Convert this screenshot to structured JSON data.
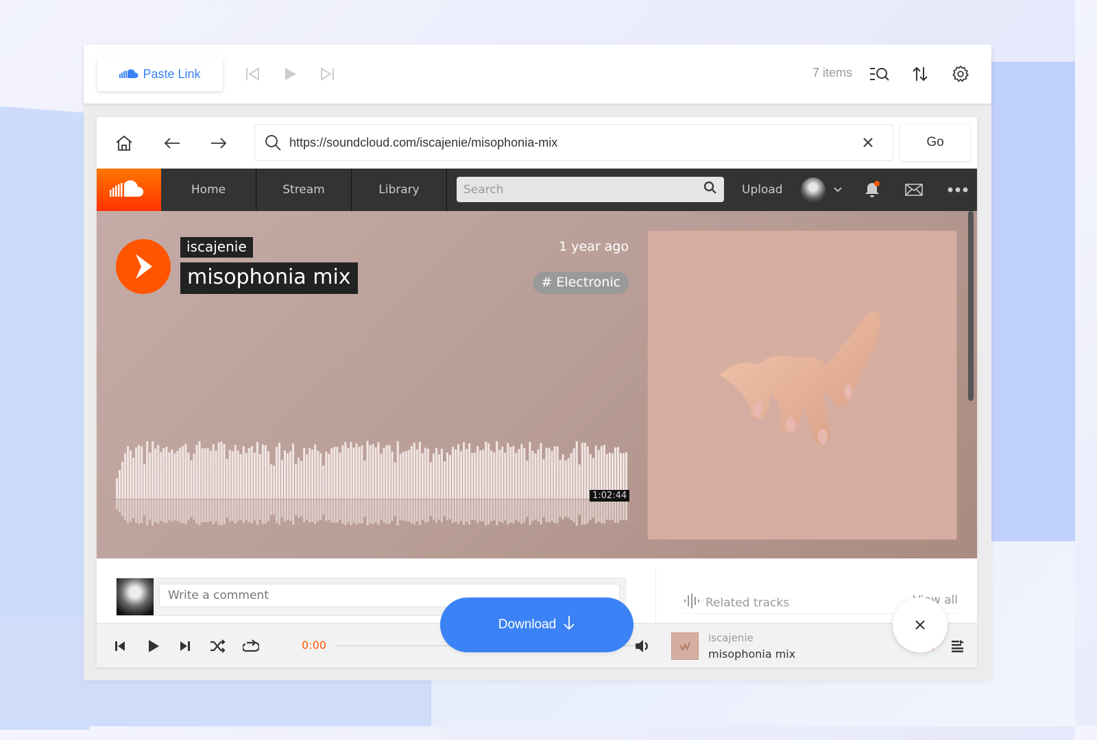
{
  "toolbar": {
    "paste_label": "Paste Link",
    "items_count": "7 items",
    "icons": [
      "cloud-icon",
      "skip-back-icon",
      "play-icon",
      "skip-forward-icon",
      "search-list-icon",
      "sort-icon",
      "settings-icon"
    ]
  },
  "browser": {
    "url": "https://soundcloud.com/iscajenie/misophonia-mix",
    "go_label": "Go"
  },
  "soundcloud": {
    "nav": [
      {
        "label": "Home"
      },
      {
        "label": "Stream"
      },
      {
        "label": "Library"
      }
    ],
    "search_placeholder": "Search",
    "upload_label": "Upload",
    "brand_color": "#ff5500",
    "track": {
      "artist": "iscajenie",
      "title": "misophonia mix",
      "posted": "1 year ago",
      "genre": "# Electronic",
      "duration": "1:02:44"
    },
    "comment_placeholder": "Write a comment",
    "related_title": "Related tracks",
    "view_all": "View all"
  },
  "player": {
    "current_time": "0:00",
    "progress": 0,
    "artist": "iscajenie",
    "title": "misophonia mix"
  },
  "overlay": {
    "download_label": "Download",
    "download_color": "#3b82f6"
  }
}
